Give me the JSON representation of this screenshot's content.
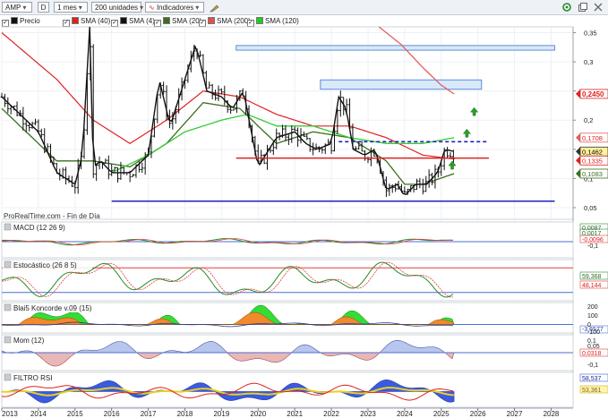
{
  "toolbar": {
    "symbol": "AMP",
    "d_label": "D",
    "period": "1 mes",
    "units": "200 unidades",
    "indicators": "Indicadores"
  },
  "legend": [
    {
      "label": "Precio",
      "color": "#111111"
    },
    {
      "label": "SMA (40)",
      "color": "#e02020"
    },
    {
      "label": "SMA (4)",
      "color": "#111111"
    },
    {
      "label": "SMA (20)",
      "color": "#3a6e1e"
    },
    {
      "label": "SMA (200)",
      "color": "#e05050"
    },
    {
      "label": "SMA (120)",
      "color": "#22cc22"
    }
  ],
  "colors": {
    "ma40": "#e02020",
    "ma20": "#3a6e1e",
    "ma120": "#33cc33",
    "ma200": "#e06060",
    "support": "#2020c0",
    "box": "#5b8fd6"
  },
  "chart_data": [
    {
      "type": "line",
      "name": "main",
      "source": "ProRealTime.com - Fin de Día",
      "ylim": [
        0.03,
        0.36
      ],
      "xlim": [
        2013.0,
        2028.6
      ],
      "y_ticks": [
        0.35,
        0.3,
        0.25,
        0.2,
        0.15,
        0.1,
        0.05
      ],
      "y_tick_labels": [
        "0,35",
        "0,3",
        "",
        "0,2",
        "",
        "0,1",
        "0,05"
      ],
      "price_x": [
        2013.0,
        2013.5,
        2014.0,
        2014.5,
        2015.0,
        2015.2,
        2015.4,
        2015.5,
        2015.7,
        2016.0,
        2016.5,
        2017.0,
        2017.3,
        2017.6,
        2018.0,
        2018.3,
        2018.6,
        2019.0,
        2019.3,
        2019.6,
        2020.0,
        2020.2,
        2020.5,
        2021.0,
        2021.3,
        2021.6,
        2022.0,
        2022.2,
        2022.4,
        2022.6,
        2022.9,
        2023.2,
        2023.5,
        2023.8,
        2024.0,
        2024.3,
        2024.6,
        2024.9,
        2025.1,
        2025.35
      ],
      "price": [
        0.24,
        0.21,
        0.18,
        0.11,
        0.09,
        0.14,
        0.36,
        0.12,
        0.13,
        0.11,
        0.11,
        0.14,
        0.27,
        0.19,
        0.27,
        0.33,
        0.25,
        0.24,
        0.22,
        0.25,
        0.12,
        0.14,
        0.17,
        0.18,
        0.16,
        0.15,
        0.16,
        0.24,
        0.22,
        0.15,
        0.14,
        0.15,
        0.08,
        0.09,
        0.07,
        0.09,
        0.09,
        0.11,
        0.15,
        0.1462
      ],
      "series": [
        {
          "name": "SMA (40)",
          "x": [
            2013.0,
            2014.5,
            2015.5,
            2016.5,
            2017.5,
            2018.5,
            2019.5,
            2020.5,
            2021.5,
            2022.5,
            2023.5,
            2024.5,
            2025.35
          ],
          "y": [
            0.35,
            0.27,
            0.2,
            0.16,
            0.2,
            0.25,
            0.24,
            0.21,
            0.19,
            0.19,
            0.17,
            0.14,
            0.1335
          ]
        },
        {
          "name": "SMA (20)",
          "x": [
            2013.0,
            2014.5,
            2015.5,
            2016.5,
            2017.5,
            2018.5,
            2019.5,
            2020.5,
            2021.5,
            2022.5,
            2023.5,
            2024.0,
            2024.5,
            2025.35
          ],
          "y": [
            0.22,
            0.13,
            0.13,
            0.12,
            0.16,
            0.23,
            0.22,
            0.16,
            0.18,
            0.17,
            0.13,
            0.09,
            0.09,
            0.1083
          ]
        },
        {
          "name": "SMA (120)",
          "x": [
            2016.0,
            2017.0,
            2018.0,
            2019.0,
            2019.7,
            2020.5,
            2021.5,
            2022.5,
            2023.5,
            2024.5,
            2025.35
          ],
          "y": [
            0.11,
            0.14,
            0.18,
            0.2,
            0.21,
            0.19,
            0.19,
            0.17,
            0.16,
            0.16,
            0.17
          ]
        },
        {
          "name": "SMA (200)",
          "x": [
            2023.3,
            2023.9,
            2024.5,
            2025.0,
            2025.35
          ],
          "y": [
            0.36,
            0.33,
            0.29,
            0.26,
            0.245
          ]
        }
      ],
      "h_lines": [
        {
          "kind": "support",
          "y": 0.061,
          "x1": 2016.0,
          "x2": 2028.1
        },
        {
          "kind": "resistance",
          "y": 0.135,
          "x1": 2019.4,
          "x2": 2026.3
        },
        {
          "kind": "dashed",
          "y": 0.163,
          "x1": 2022.2,
          "x2": 2026.3
        }
      ],
      "boxes": [
        {
          "x1": 2019.4,
          "x2": 2028.1,
          "y1": 0.32,
          "y2": 0.328
        },
        {
          "x1": 2021.7,
          "x2": 2026.1,
          "y1": 0.253,
          "y2": 0.269
        }
      ],
      "arrows": [
        {
          "x": 2025.3,
          "y": 0.122
        },
        {
          "x": 2025.7,
          "y": 0.177
        },
        {
          "x": 2025.9,
          "y": 0.214
        }
      ],
      "value_tags": [
        {
          "y": 0.245,
          "label": "0,2450",
          "color": "#e02020",
          "bg": "#ffffff",
          "fg": "#e02020",
          "bold": true
        },
        {
          "y": 0.17,
          "label": "0,1708",
          "color": "#e06060",
          "bg": "#ffffff",
          "fg": "#e02020"
        },
        {
          "y": 0.1462,
          "label": "0,1462",
          "color": "#333333",
          "bg": "#fff2a0",
          "fg": "#000000"
        },
        {
          "y": 0.1335,
          "label": "0,1335",
          "color": "#e02020",
          "bg": "#ffffff",
          "fg": "#e02020"
        },
        {
          "y": 0.1083,
          "label": "0,1083",
          "color": "#3a6e1e",
          "bg": "#ffffff",
          "fg": "#3a6e1e"
        }
      ]
    },
    {
      "type": "line",
      "name": "MACD (12 26 9)",
      "ylim": [
        -0.03,
        0.01
      ],
      "value_labels": [
        "0,0087",
        "0,0017",
        "-0,0096"
      ]
    },
    {
      "type": "line",
      "name": "Estocástico (26 8 5)",
      "ylim": [
        0,
        100
      ],
      "value_labels": [
        "59,368",
        "48,144"
      ]
    },
    {
      "type": "area",
      "name": "Blai5 Koncorde v.09 (15)",
      "y_tick_labels": [
        "200",
        "100",
        "0",
        "-100"
      ],
      "value_labels": [
        "-3,6577"
      ]
    },
    {
      "type": "area",
      "name": "Mom (12)",
      "y_tick_labels": [
        "0,1",
        "0,05",
        "-0,1"
      ],
      "value_labels": [
        "0,0318"
      ]
    },
    {
      "type": "area",
      "name": "FILTRO RSI",
      "value_labels": [
        "58,537",
        "53,361"
      ]
    },
    {
      "type": "table",
      "name": "x-axis",
      "x_ticks": [
        2013,
        2014,
        2015,
        2016,
        2017,
        2018,
        2019,
        2020,
        2021,
        2022,
        2023,
        2024,
        2025,
        2026,
        2027,
        2028
      ],
      "x_tick_labels": [
        "2013",
        "2014",
        "2015",
        "2016",
        "2017",
        "2018",
        "2019",
        "2020",
        "2021",
        "2022",
        "2023",
        "2024",
        "2025",
        "2026",
        "2027",
        "2028"
      ]
    }
  ]
}
